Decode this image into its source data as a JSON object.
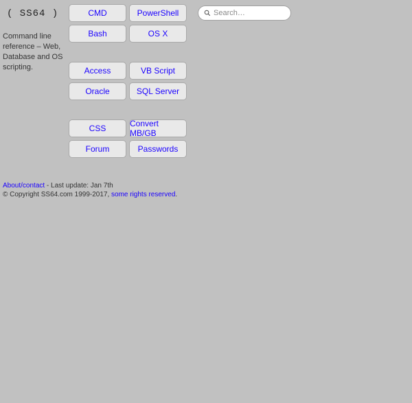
{
  "logo": "(  SS64  )",
  "tagline": "Command line reference – Web, Database and OS scripting.",
  "search": {
    "placeholder": "Search…"
  },
  "groups": [
    {
      "items": [
        {
          "id": "cmd",
          "label": "CMD"
        },
        {
          "id": "powershell",
          "label": "PowerShell"
        },
        {
          "id": "bash",
          "label": "Bash"
        },
        {
          "id": "osx",
          "label": "OS X"
        }
      ]
    },
    {
      "items": [
        {
          "id": "access",
          "label": "Access"
        },
        {
          "id": "vbscript",
          "label": "VB Script"
        },
        {
          "id": "oracle",
          "label": "Oracle"
        },
        {
          "id": "sqlserver",
          "label": "SQL Server"
        }
      ]
    },
    {
      "items": [
        {
          "id": "css",
          "label": "CSS"
        },
        {
          "id": "convert",
          "label": "Convert MB/GB"
        },
        {
          "id": "forum",
          "label": "Forum"
        },
        {
          "id": "passwords",
          "label": "Passwords"
        }
      ]
    }
  ],
  "footer": {
    "about_label": "About/contact",
    "update_text": " - Last update: Jan 7th",
    "copyright_prefix": "© Copyright SS64.com 1999-2017, ",
    "rights_label": "some rights reserved",
    "copyright_suffix": "."
  }
}
